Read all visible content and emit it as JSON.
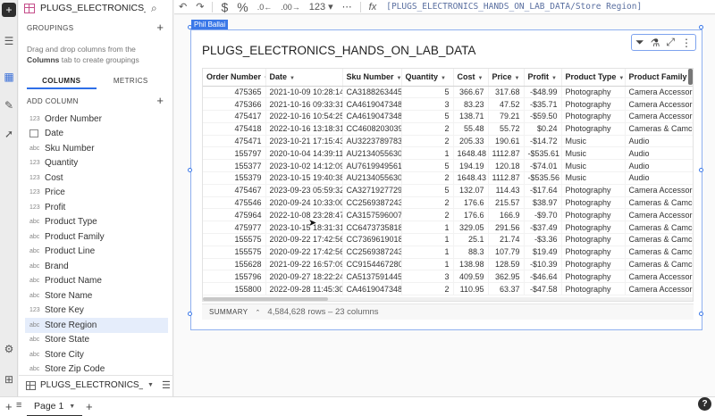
{
  "panel": {
    "title": "PLUGS_ELECTRONICS_HAND...",
    "groupings_header": "GROUPINGS",
    "hint_prefix": "Drag and drop columns from the",
    "hint_bold": "Columns",
    "hint_suffix": "tab to create groupings",
    "tabs": [
      "COLUMNS",
      "METRICS"
    ],
    "add_column_label": "ADD COLUMN",
    "columns": [
      {
        "type": "123",
        "name": "Order Number"
      },
      {
        "type": "date",
        "name": "Date"
      },
      {
        "type": "abc",
        "name": "Sku Number"
      },
      {
        "type": "123",
        "name": "Quantity"
      },
      {
        "type": "123",
        "name": "Cost"
      },
      {
        "type": "123",
        "name": "Price"
      },
      {
        "type": "123",
        "name": "Profit"
      },
      {
        "type": "abc",
        "name": "Product Type"
      },
      {
        "type": "abc",
        "name": "Product Family"
      },
      {
        "type": "abc",
        "name": "Product Line"
      },
      {
        "type": "abc",
        "name": "Brand"
      },
      {
        "type": "abc",
        "name": "Product Name"
      },
      {
        "type": "abc",
        "name": "Store Name"
      },
      {
        "type": "123",
        "name": "Store Key"
      },
      {
        "type": "abc",
        "name": "Store Region"
      },
      {
        "type": "abc",
        "name": "Store State"
      },
      {
        "type": "abc",
        "name": "Store City"
      },
      {
        "type": "abc",
        "name": "Store Zip Code"
      }
    ],
    "selected_column": "Store Region",
    "source_name": "PLUGS_ELECTRONICS_H..."
  },
  "toolbar": {
    "number_format": "123",
    "formula_icon": "fx",
    "formula": "[PLUGS_ELECTRONICS_HANDS_ON_LAB_DATA/Store Region]"
  },
  "element": {
    "badge": "Phil Ballai",
    "title": "PLUGS_ELECTRONICS_HANDS_ON_LAB_DATA",
    "summary_label": "SUMMARY",
    "summary_info": "4,584,628 rows – 23 columns"
  },
  "table": {
    "headers": [
      "Order Number",
      "Date",
      "Sku Number",
      "Quantity",
      "Cost",
      "Price",
      "Profit",
      "Product Type",
      "Product Family"
    ],
    "rows": [
      [
        "475365",
        "2021-10-09 10:28:14",
        "CA3188263445",
        "5",
        "366.67",
        "317.68",
        "-$48.99",
        "Photography",
        "Camera Accessories"
      ],
      [
        "475366",
        "2021-10-16 09:33:31",
        "CA4619047348",
        "3",
        "83.23",
        "47.52",
        "-$35.71",
        "Photography",
        "Camera Accessories"
      ],
      [
        "475417",
        "2022-10-16 10:54:25",
        "CA4619047348",
        "5",
        "138.71",
        "79.21",
        "-$59.50",
        "Photography",
        "Camera Accessories"
      ],
      [
        "475418",
        "2022-10-16 13:18:31",
        "CC4608203039",
        "2",
        "55.48",
        "55.72",
        "$0.24",
        "Photography",
        "Cameras & Camcorde"
      ],
      [
        "475471",
        "2023-10-21 17:15:43",
        "AU3223789783",
        "2",
        "205.33",
        "190.61",
        "-$14.72",
        "Music",
        "Audio"
      ],
      [
        "155797",
        "2020-10-04 14:39:11",
        "AU2134055630",
        "1",
        "1648.48",
        "1112.87",
        "-$535.61",
        "Music",
        "Audio"
      ],
      [
        "155377",
        "2023-10-02 14:12:09",
        "AU7619949561",
        "5",
        "194.19",
        "120.18",
        "-$74.01",
        "Music",
        "Audio"
      ],
      [
        "155379",
        "2023-10-15 19:40:38",
        "AU2134055630",
        "2",
        "1648.43",
        "1112.87",
        "-$535.56",
        "Music",
        "Audio"
      ],
      [
        "475467",
        "2023-09-23 05:59:32",
        "CA3271927729",
        "5",
        "132.07",
        "114.43",
        "-$17.64",
        "Photography",
        "Camera Accessories"
      ],
      [
        "475546",
        "2020-09-24 10:33:00",
        "CC2569387243",
        "2",
        "176.6",
        "215.57",
        "$38.97",
        "Photography",
        "Cameras & Camcorde"
      ],
      [
        "475964",
        "2022-10-08 23:28:47",
        "CA3157596007",
        "2",
        "176.6",
        "166.9",
        "-$9.70",
        "Photography",
        "Camera Accessories"
      ],
      [
        "475977",
        "2023-10-15 18:31:31",
        "CC6473735818",
        "1",
        "329.05",
        "291.56",
        "-$37.49",
        "Photography",
        "Cameras & Camcorde"
      ],
      [
        "155575",
        "2020-09-22 17:42:56",
        "CC7369619018",
        "1",
        "25.1",
        "21.74",
        "-$3.36",
        "Photography",
        "Cameras & Camcorde"
      ],
      [
        "155575",
        "2020-09-22 17:42:56",
        "CC2569387243",
        "1",
        "88.3",
        "107.79",
        "$19.49",
        "Photography",
        "Cameras & Camcorde"
      ],
      [
        "155628",
        "2021-09-22 16:57:09",
        "CC9154467280",
        "1",
        "138.98",
        "128.59",
        "-$10.39",
        "Photography",
        "Cameras & Camcorde"
      ],
      [
        "155796",
        "2020-09-27 18:22:24",
        "CA5137591445",
        "3",
        "409.59",
        "362.95",
        "-$46.64",
        "Photography",
        "Camera Accessories"
      ],
      [
        "155800",
        "2022-09-28 11:45:30",
        "CA4619047348",
        "2",
        "110.95",
        "63.37",
        "-$47.58",
        "Photography",
        "Camera Accessories"
      ]
    ]
  },
  "bottom": {
    "page_tab": "Page 1",
    "help": "?"
  }
}
